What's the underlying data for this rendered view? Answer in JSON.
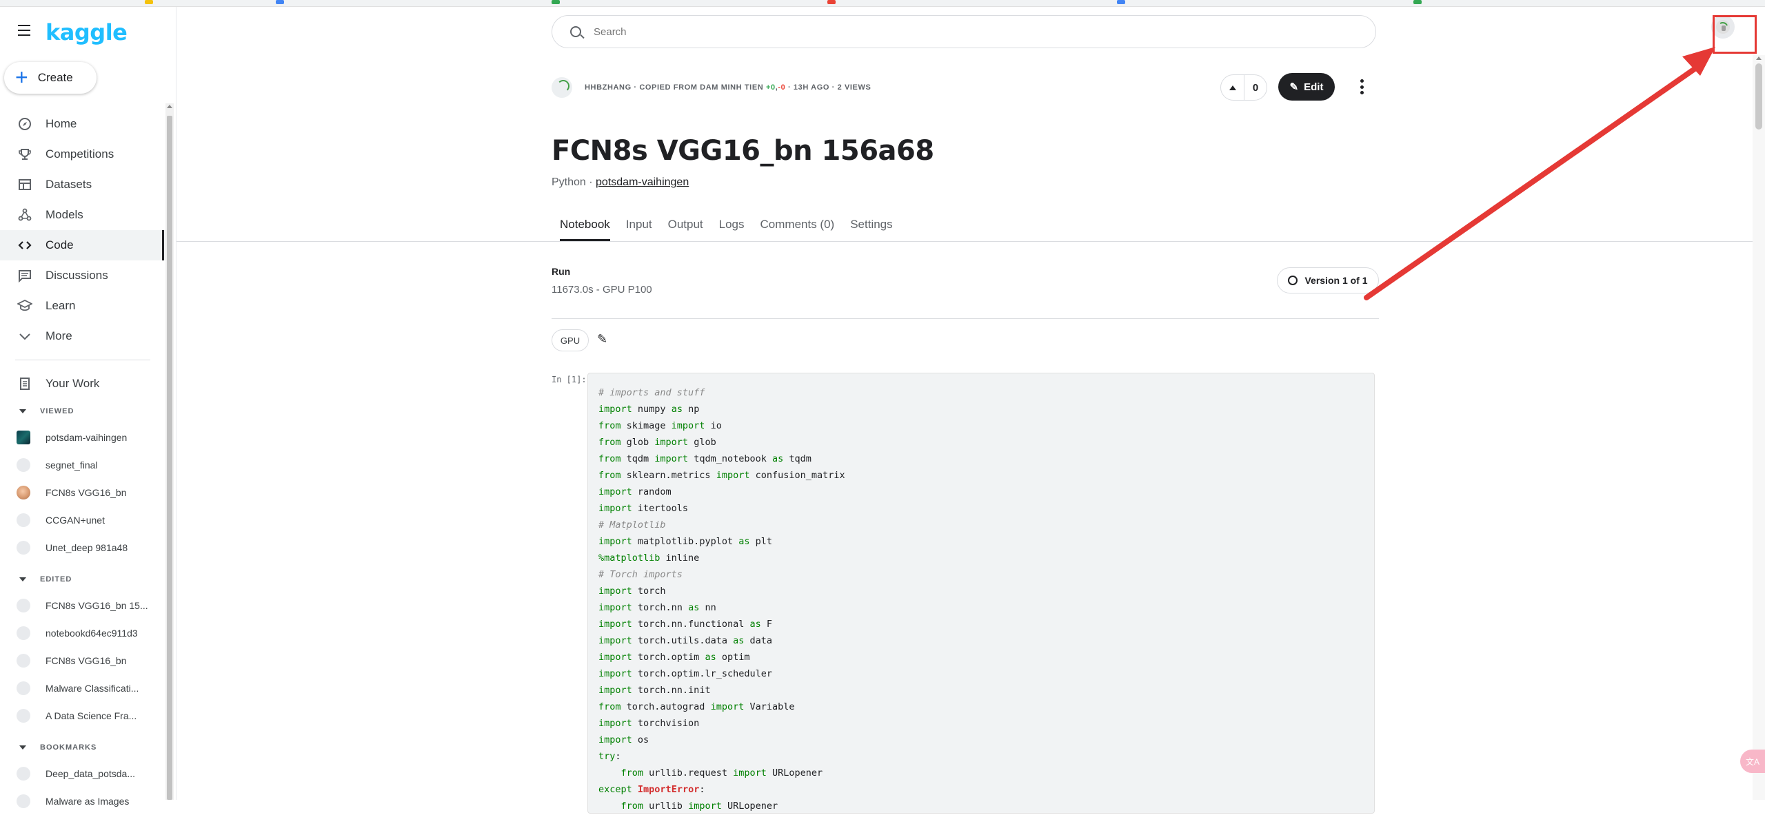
{
  "brand": {
    "logo_text": "kaggle"
  },
  "sidebar": {
    "create_label": "Create",
    "nav": [
      {
        "label": "Home",
        "icon": "compass-icon"
      },
      {
        "label": "Competitions",
        "icon": "trophy-icon"
      },
      {
        "label": "Datasets",
        "icon": "table-icon"
      },
      {
        "label": "Models",
        "icon": "models-icon"
      },
      {
        "label": "Code",
        "icon": "code-icon"
      },
      {
        "label": "Discussions",
        "icon": "discussions-icon"
      },
      {
        "label": "Learn",
        "icon": "learn-icon"
      },
      {
        "label": "More",
        "icon": "chevron-down-icon"
      }
    ],
    "your_work": "Your Work",
    "viewed_header": "VIEWED",
    "viewed": [
      "potsdam-vaihingen",
      "segnet_final",
      "FCN8s VGG16_bn",
      "CCGAN+unet",
      "Unet_deep 981a48"
    ],
    "edited_header": "EDITED",
    "edited": [
      "FCN8s VGG16_bn 15...",
      "notebookd64ec911d3",
      "FCN8s VGG16_bn",
      "Malware Classificati...",
      "A Data Science Fra..."
    ],
    "bookmarks_header": "BOOKMARKS",
    "bookmarks": [
      "Deep_data_potsda...",
      "Malware as Images"
    ]
  },
  "search": {
    "placeholder": "Search"
  },
  "notebook": {
    "meta_prefix": "HHBZHANG · COPIED FROM DAM MINH TIEN ",
    "meta_pos": "+0",
    "meta_sep": ",",
    "meta_neg": "-0",
    "meta_suffix": " · 13H AGO · 2 VIEWS",
    "votes": "0",
    "edit_label": "Edit",
    "title": "FCN8s VGG16_bn 156a68",
    "language": "Python",
    "language_sep": " · ",
    "dataset": "potsdam-vaihingen",
    "tabs": [
      "Notebook",
      "Input",
      "Output",
      "Logs",
      "Comments (0)",
      "Settings"
    ],
    "run_label": "Run",
    "run_info": "11673.0s - GPU P100",
    "version_label": "Version 1 of 1",
    "accelerator": "GPU",
    "in_prompt": "In [1]:"
  },
  "code_lines": [
    [
      [
        "cm",
        "# imports and stuff"
      ]
    ],
    [
      [
        "kw",
        "import"
      ],
      [
        "",
        " numpy "
      ],
      [
        "kw",
        "as"
      ],
      [
        "",
        " np"
      ]
    ],
    [
      [
        "kw",
        "from"
      ],
      [
        "",
        " skimage "
      ],
      [
        "kw",
        "import"
      ],
      [
        "",
        " io"
      ]
    ],
    [
      [
        "kw",
        "from"
      ],
      [
        "",
        " glob "
      ],
      [
        "kw",
        "import"
      ],
      [
        "",
        " glob"
      ]
    ],
    [
      [
        "kw",
        "from"
      ],
      [
        "",
        " tqdm "
      ],
      [
        "kw",
        "import"
      ],
      [
        "",
        " tqdm_notebook "
      ],
      [
        "kw",
        "as"
      ],
      [
        "",
        " tqdm"
      ]
    ],
    [
      [
        "kw",
        "from"
      ],
      [
        "",
        " sklearn.metrics "
      ],
      [
        "kw",
        "import"
      ],
      [
        "",
        " confusion_matrix"
      ]
    ],
    [
      [
        "kw",
        "import"
      ],
      [
        "",
        " random"
      ]
    ],
    [
      [
        "kw",
        "import"
      ],
      [
        "",
        " itertools"
      ]
    ],
    [
      [
        "cm",
        "# Matplotlib"
      ]
    ],
    [
      [
        "kw",
        "import"
      ],
      [
        "",
        " matplotlib.pyplot "
      ],
      [
        "kw",
        "as"
      ],
      [
        "",
        " plt"
      ]
    ],
    [
      [
        "kw",
        "%matplotlib"
      ],
      [
        "",
        " inline"
      ]
    ],
    [
      [
        "cm",
        "# Torch imports"
      ]
    ],
    [
      [
        "kw",
        "import"
      ],
      [
        "",
        " torch"
      ]
    ],
    [
      [
        "kw",
        "import"
      ],
      [
        "",
        " torch.nn "
      ],
      [
        "kw",
        "as"
      ],
      [
        "",
        " nn"
      ]
    ],
    [
      [
        "kw",
        "import"
      ],
      [
        "",
        " torch.nn.functional "
      ],
      [
        "kw",
        "as"
      ],
      [
        "",
        " F"
      ]
    ],
    [
      [
        "kw",
        "import"
      ],
      [
        "",
        " torch.utils.data "
      ],
      [
        "kw",
        "as"
      ],
      [
        "",
        " data"
      ]
    ],
    [
      [
        "kw",
        "import"
      ],
      [
        "",
        " torch.optim "
      ],
      [
        "kw",
        "as"
      ],
      [
        "",
        " optim"
      ]
    ],
    [
      [
        "kw",
        "import"
      ],
      [
        "",
        " torch.optim.lr_scheduler"
      ]
    ],
    [
      [
        "kw",
        "import"
      ],
      [
        "",
        " torch.nn.init"
      ]
    ],
    [
      [
        "kw",
        "from"
      ],
      [
        "",
        " torch.autograd "
      ],
      [
        "kw",
        "import"
      ],
      [
        "",
        " Variable"
      ]
    ],
    [
      [
        "kw",
        "import"
      ],
      [
        "",
        " torchvision"
      ]
    ],
    [
      [
        "kw",
        "import"
      ],
      [
        "",
        " os"
      ]
    ],
    [
      [
        "kw",
        "try"
      ],
      [
        "",
        ":"
      ]
    ],
    [
      [
        "",
        "    "
      ],
      [
        "kw",
        "from"
      ],
      [
        "",
        " urllib.request "
      ],
      [
        "kw",
        "import"
      ],
      [
        "",
        " URLopener"
      ]
    ],
    [
      [
        "kw",
        "except"
      ],
      [
        "",
        " "
      ],
      [
        "ex",
        "ImportError"
      ],
      [
        "",
        ":"
      ]
    ],
    [
      [
        "",
        "    "
      ],
      [
        "kw",
        "from"
      ],
      [
        "",
        " urllib "
      ],
      [
        "kw",
        "import"
      ],
      [
        "",
        " URLopener"
      ]
    ]
  ],
  "annotation": {
    "color": "#e53935"
  }
}
